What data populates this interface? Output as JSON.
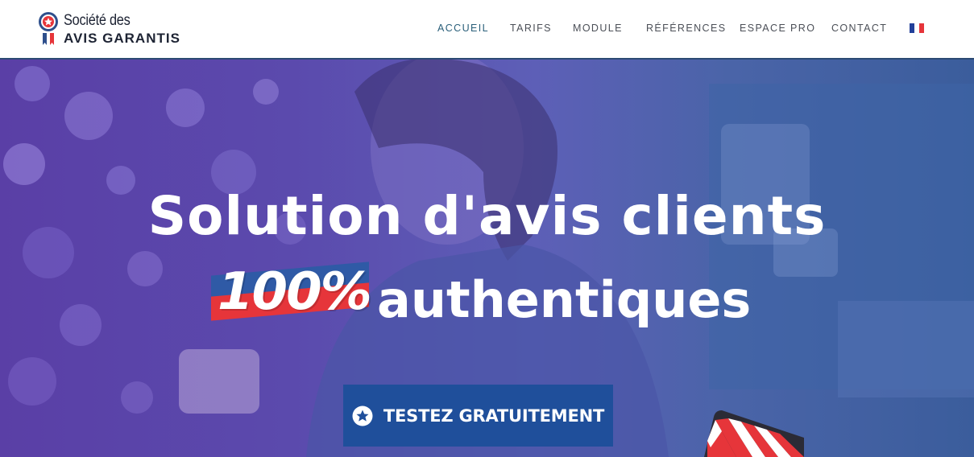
{
  "header": {
    "logo": {
      "line1": "Société des",
      "line2": "AVIS GARANTIS"
    },
    "nav": [
      {
        "label": "ACCUEIL",
        "active": true
      },
      {
        "label": "TARIFS",
        "active": false
      },
      {
        "label": "MODULE",
        "active": false
      },
      {
        "label": "RÉFÉRENCES",
        "active": false
      },
      {
        "label": "ESPACE PRO",
        "active": false
      },
      {
        "label": "CONTACT",
        "active": false
      }
    ],
    "language_flag": "fr-flag-icon"
  },
  "hero": {
    "title_line1": "Solution d'avis clients",
    "badge_text": "100%",
    "title_line2": "authentiques",
    "cta": {
      "label": "TESTEZ GRATUITEMENT",
      "icon": "star-circle-icon"
    }
  },
  "colors": {
    "brand_blue": "#1f4f9b",
    "brand_red": "#e6353a",
    "nav_active": "#2a5f7a",
    "hero_overlay": "#5b4aad"
  }
}
